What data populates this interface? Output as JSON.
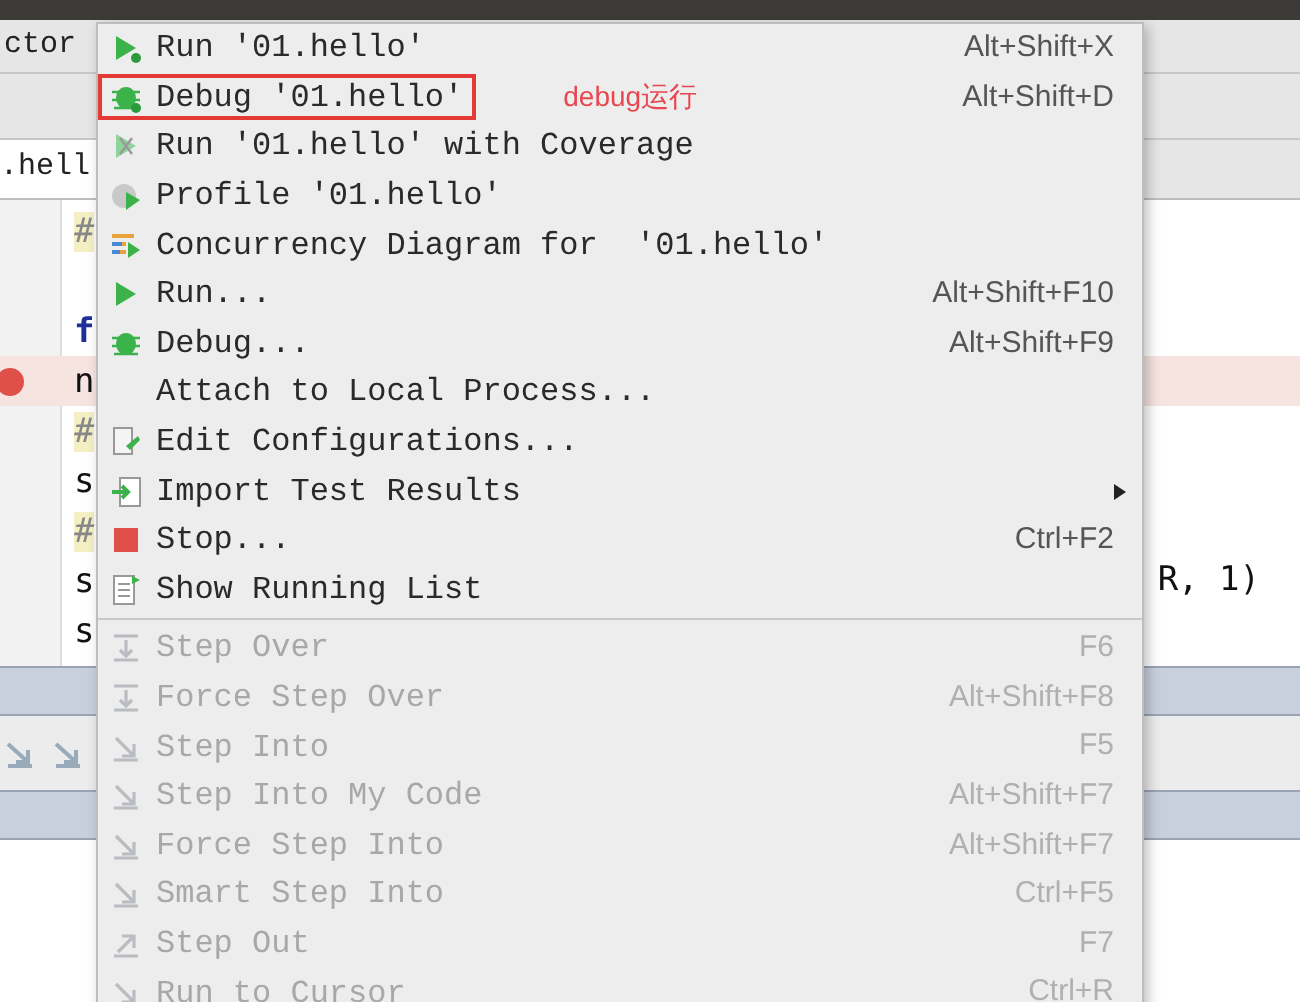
{
  "toolbar": {
    "text": "ctor"
  },
  "editor_tab": {
    "label": ".hell"
  },
  "code_lines": [
    {
      "text": "#",
      "kind": "comment",
      "breakpoint": false,
      "highlighted": false
    },
    {
      "kind": "blank",
      "breakpoint": false,
      "highlighted": false
    },
    {
      "text": "f",
      "kind": "keyword",
      "breakpoint": false,
      "highlighted": false
    },
    {
      "text": "n",
      "kind": "name",
      "breakpoint": true,
      "highlighted": true
    },
    {
      "text": "#",
      "kind": "comment",
      "breakpoint": false,
      "highlighted": false
    },
    {
      "text": "s",
      "kind": "name",
      "breakpoint": false,
      "highlighted": false
    },
    {
      "text": "#",
      "kind": "comment",
      "breakpoint": false,
      "highlighted": false
    },
    {
      "text": "s",
      "kind": "name",
      "breakpoint": false,
      "highlighted": false,
      "tail": "R, 1)"
    },
    {
      "text": "s",
      "kind": "name",
      "breakpoint": false,
      "highlighted": false
    }
  ],
  "menu": {
    "items": [
      {
        "label": "Run '01.hello'",
        "shortcut": "Alt+Shift+X",
        "kind": "run",
        "disabled": false
      },
      {
        "label": "Debug '01.hello'",
        "shortcut": "Alt+Shift+D",
        "kind": "debug",
        "disabled": false,
        "annotation": "debug运行"
      },
      {
        "label": "Run '01.hello' with Coverage",
        "kind": "coverage",
        "disabled": false
      },
      {
        "label": "Profile '01.hello'",
        "kind": "profile",
        "disabled": false
      },
      {
        "label": "Concurrency Diagram for  '01.hello'",
        "kind": "concurrency",
        "disabled": false
      },
      {
        "label": "Run...",
        "shortcut": "Alt+Shift+F10",
        "kind": "runplain",
        "disabled": false
      },
      {
        "label": "Debug...",
        "shortcut": "Alt+Shift+F9",
        "kind": "debugplain",
        "disabled": false
      },
      {
        "label": "Attach to Local Process...",
        "kind": "plain",
        "disabled": false
      },
      {
        "label": "Edit Configurations...",
        "kind": "edit",
        "disabled": false
      },
      {
        "label": "Import Test Results",
        "kind": "import",
        "disabled": false,
        "submenu": true
      },
      {
        "label": "Stop...",
        "shortcut": "Ctrl+F2",
        "kind": "stop",
        "disabled": false
      },
      {
        "label": "Show Running List",
        "kind": "list",
        "disabled": false
      },
      {
        "label": "Step Over",
        "shortcut": "F6",
        "kind": "stepover",
        "disabled": true,
        "separator_before": true
      },
      {
        "label": "Force Step Over",
        "shortcut": "Alt+Shift+F8",
        "kind": "stepover",
        "disabled": true
      },
      {
        "label": "Step Into",
        "shortcut": "F5",
        "kind": "stepinto",
        "disabled": true
      },
      {
        "label": "Step Into My Code",
        "shortcut": "Alt+Shift+F7",
        "kind": "stepinto",
        "disabled": true
      },
      {
        "label": "Force Step Into",
        "shortcut": "Alt+Shift+F7",
        "kind": "stepinto",
        "disabled": true
      },
      {
        "label": "Smart Step Into",
        "shortcut": "Ctrl+F5",
        "kind": "stepinto",
        "disabled": true
      },
      {
        "label": "Step Out",
        "shortcut": "F7",
        "kind": "stepout",
        "disabled": true
      },
      {
        "label": "Run to Cursor",
        "shortcut": "Ctrl+R",
        "kind": "stepinto",
        "disabled": true
      }
    ]
  }
}
